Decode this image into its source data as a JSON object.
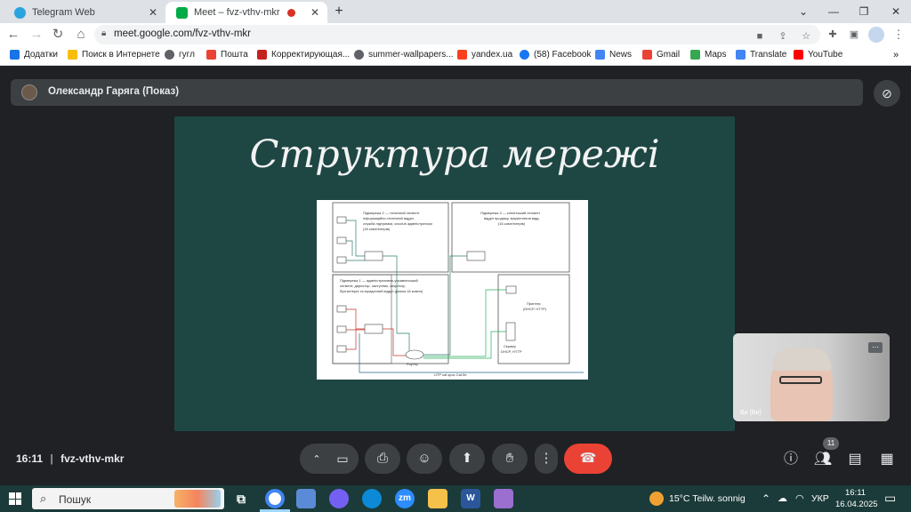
{
  "browser": {
    "tabs": [
      {
        "label": "Telegram Web",
        "icon": "telegram-icon",
        "color": "#2aa3df",
        "active": false
      },
      {
        "label": "Meet – fvz-vthv-mkr",
        "icon": "meet-icon",
        "color": "#00ac47",
        "active": true
      }
    ],
    "new_tab": "+",
    "url": "meet.google.com/fvz-vthv-mkr",
    "bookmarks": [
      {
        "label": "Додатки",
        "icon": "apps-grid-icon",
        "color": "#1a73e8"
      },
      {
        "label": "Поиск в Интернете",
        "icon": "search-globe-icon",
        "color": "#fbbc04"
      },
      {
        "label": "гугл",
        "icon": "globe-icon",
        "color": "#5f6368"
      },
      {
        "label": "Пошта",
        "icon": "mail-icon",
        "color": "#ea4335"
      },
      {
        "label": "Корректирующая...",
        "icon": "clapper-icon",
        "color": "#c5221f"
      },
      {
        "label": "summer-wallpapers...",
        "icon": "globe-icon",
        "color": "#5f6368"
      },
      {
        "label": "yandex.ua",
        "icon": "yandex-icon",
        "color": "#fc3f1d"
      },
      {
        "label": "(58) Facebook",
        "icon": "facebook-icon",
        "color": "#1877f2"
      },
      {
        "label": "News",
        "icon": "news-icon",
        "color": "#4285f4"
      },
      {
        "label": "Gmail",
        "icon": "gmail-icon",
        "color": "#ea4335"
      },
      {
        "label": "Maps",
        "icon": "maps-icon",
        "color": "#34a853"
      },
      {
        "label": "Translate",
        "icon": "translate-icon",
        "color": "#4285f4"
      },
      {
        "label": "YouTube",
        "icon": "youtube-icon",
        "color": "#ff0000"
      }
    ],
    "bookmarks_more": "»"
  },
  "meet": {
    "presenter_label": "Олександр Гаряга (Показ)",
    "slide": {
      "title": "Структура мережі",
      "diagram": {
        "subnet2": [
          "Підмережа 2 — технічний сегмент",
          "інформаційно-технічний відділ,",
          "служба підтримки, сисclub адміністратори",
          "(18 комп'ютерів)"
        ],
        "subnet3": [
          "Підмережа 3 — клієнтський сегмент",
          "відділ продажу, маркетингов відд.",
          "(16 комп'ютерів)"
        ],
        "subnet1": [
          "Підмережа 1 — адміністративно-управлінський",
          "сегмент, директор, заступник, секретар,",
          "бухгалтерія та юридичний відділ (разом 18 компл)"
        ],
        "printer": [
          "Принтер",
          "(DHCP, HTTP)"
        ],
        "server": [
          "Сервер",
          "DHCP, HTTP"
        ],
        "router": "Роутер",
        "bottom_label": "UTP cat крос Cat.5e"
      }
    },
    "self_view_name": "Ви (Ви)",
    "meeting_time": "16:11",
    "meeting_code": "fvz-vthv-mkr",
    "people_count": "11"
  },
  "taskbar": {
    "search_placeholder": "Пошук",
    "weather": "15°C  Teilw. sonnig",
    "language": "УКР",
    "time": "16:11",
    "date": "16.04.2025",
    "apps": [
      {
        "name": "task-view-icon",
        "color": "#2b4a49"
      },
      {
        "name": "chrome-icon",
        "color": "#4285f4"
      },
      {
        "name": "paint-icon",
        "color": "#5b8bd6"
      },
      {
        "name": "viber-icon",
        "color": "#7360f2"
      },
      {
        "name": "edge-icon",
        "color": "#0c8ad8"
      },
      {
        "name": "zoom-icon",
        "color": "#2d8cff"
      },
      {
        "name": "file-explorer-icon",
        "color": "#f6c14b"
      },
      {
        "name": "word-icon",
        "color": "#2b579a"
      },
      {
        "name": "paint-3d-icon",
        "color": "#9a6fd0"
      }
    ]
  }
}
